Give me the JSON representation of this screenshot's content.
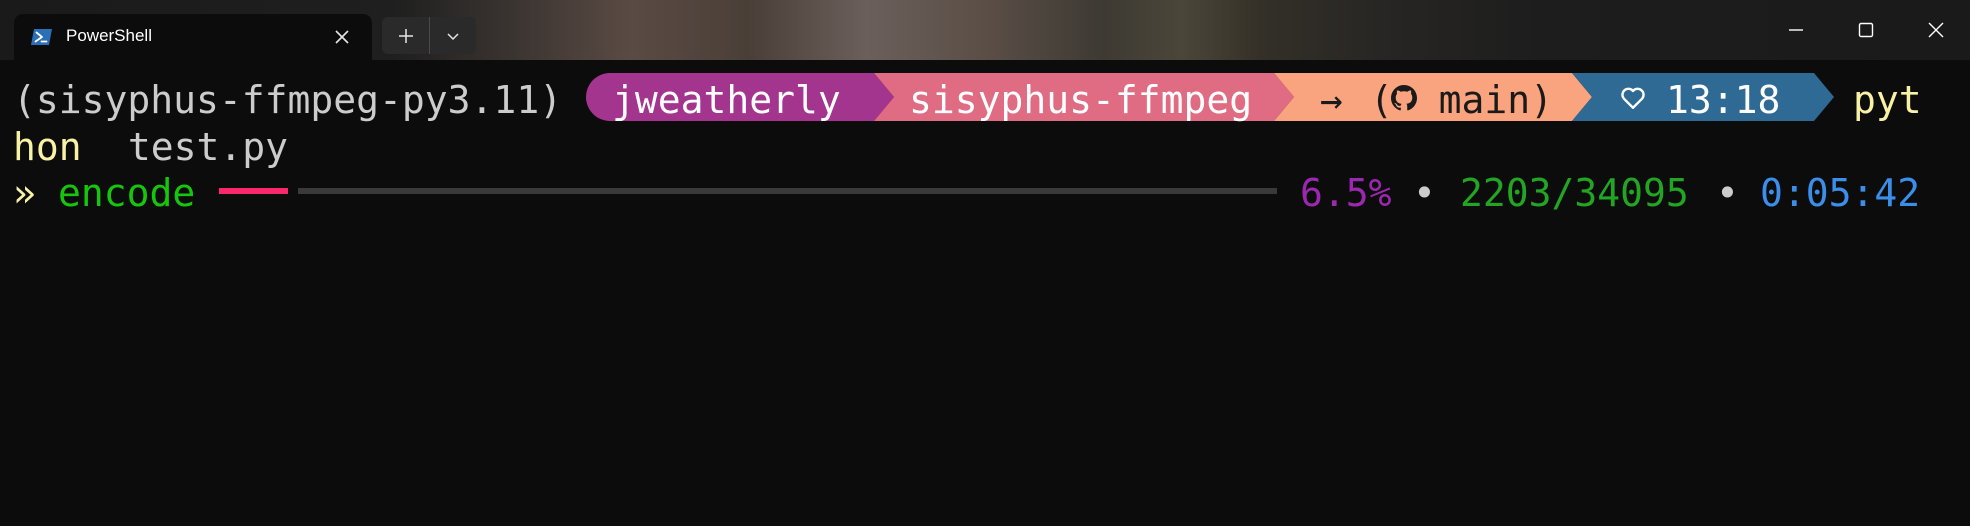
{
  "window": {
    "tab_title": "PowerShell",
    "tab_icon": "powershell-icon",
    "new_tab_icon": "plus-icon",
    "dropdown_icon": "chevron-down-icon",
    "controls": [
      "minimize-icon",
      "maximize-icon",
      "close-icon"
    ]
  },
  "prompt": {
    "venv": "(sisyphus-ffmpeg-py3.11)",
    "user": "jweatherly",
    "path": "sisyphus-ffmpeg",
    "git_arrow": "→",
    "git_branch": "(  main)",
    "git_icon": "github-icon",
    "time_icon": "heart-icon",
    "time": "13:18",
    "segment_colors": [
      "#a3358f",
      "#e06c84",
      "#f9a37f",
      "#2e6a94"
    ]
  },
  "command": {
    "line1": "pyt",
    "line2_part1": "hon",
    "line2_part2": " test.py"
  },
  "progress": {
    "chevron": "»",
    "label": "encode",
    "fraction": 0.065,
    "percent": "6.5%",
    "separator": "•",
    "count": "2203/34095",
    "elapsed": "0:05:42",
    "bar_color": "#f9286a",
    "track_color": "#3a3a3a"
  }
}
